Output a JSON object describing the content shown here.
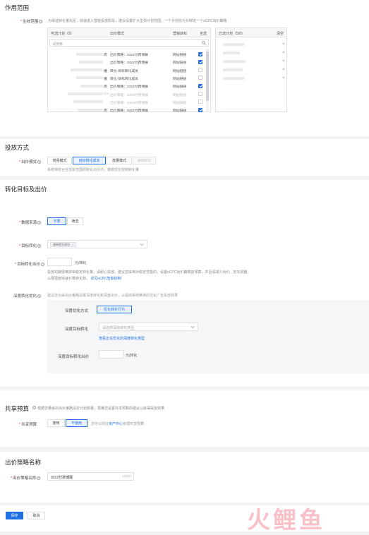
{
  "scope": {
    "title": "作用范围",
    "label": "生效范围",
    "hint": "为保证转化量充足，快速进入智能投放阶段，建议设置扩大生效计划范围。一个计划仅允许绑定一个oCPC出价策略",
    "available": {
      "header": "可选计划（8）",
      "col_bid": "出价模式",
      "col_target": "营销目标",
      "select_all": "全选",
      "search_placeholder": "请搜索",
      "rows": [
        {
          "suffix": "周",
          "bid": "出价策略：0322付费博展",
          "target": "网站链接",
          "checked": true,
          "muted": false
        },
        {
          "suffix": "",
          "bid": "出价策略：0322付费博展",
          "target": "网站链接",
          "checked": true,
          "muted": false
        },
        {
          "suffix": "槽",
          "bid": "转化-目标转化成本",
          "target": "网站链接",
          "checked": false,
          "muted": false
        },
        {
          "suffix": "槽",
          "bid": "转化-目标转化成本",
          "target": "网站链接",
          "checked": false,
          "muted": false
        },
        {
          "suffix": "周",
          "bid": "出价策略：0322付费博展",
          "target": "网站链接",
          "checked": true,
          "muted": false
        },
        {
          "suffix": "GX",
          "bid": "出价策略：0322付费博展",
          "target": "网站链接",
          "checked": false,
          "muted": true
        },
        {
          "suffix": "",
          "bid": "出价策略：0322付费博展",
          "target": "网站链接",
          "checked": false,
          "muted": true
        },
        {
          "suffix": "周",
          "bid": "出价策略：0322付费博展",
          "target": "网站链接",
          "checked": true,
          "muted": false
        }
      ]
    },
    "selected": {
      "header": "已选计划（5/8）",
      "clear": "清空",
      "count": 5
    }
  },
  "bidding": {
    "title": "投放方式",
    "label": "出价模式",
    "options": [
      "增强模式",
      "目标转化成本",
      "放量模式",
      "目标ROI"
    ],
    "active_index": 1,
    "disabled_index": 3,
    "hint": "系统将结合在放投范围的转化出价内，着眼优化控制转化量"
  },
  "conversion": {
    "title": "转化目标及出价",
    "source_label": "数据来源",
    "source_options": [
      "不限",
      "筛选"
    ],
    "source_active": 0,
    "target_label": "目标转化",
    "target_tag": "表单提交成功",
    "price_label": "目标转化出价",
    "price_unit": "元/转化",
    "price_hint": "投放初期很难获得稳定转化量，请耐心投放。建议您采用对稳定性能的，设置oCPC出价策略前预算，并且请减少出价、定向调整，以便更能快速计算转化数。",
    "price_link": "详见oCPC智能控制",
    "deep_label": "深度转化优化",
    "deep_hint": "建议您为采出价策略设置深度转化和深度出价，以提高系统精准的优化广告投放效果",
    "deep_mode_label": "深度优化方式",
    "deep_mode_btn": "优化转化行为",
    "deep_target_label": "深度目标转化",
    "deep_target_placeholder": "请选择深度转化类型",
    "deep_target_link": "查看正在优化的深度转化类型",
    "deep_price_label": "深度目标转化出价",
    "deep_price_unit": "元/转化"
  },
  "budget": {
    "title": "共享预算",
    "hint": "根据您量级的出价策略设定计划数量，再推您设置共享预算的建议以获得投放效果",
    "label": "共享预算",
    "options": [
      "使用",
      "不使用"
    ],
    "active_index": 1,
    "note_prefix": "您可以前往",
    "note_link": "资产中心",
    "note_suffix": "管理共享预算"
  },
  "strategy": {
    "title": "出价策略名称",
    "label": "出价策略名称",
    "value": "0322付费博展",
    "counter": "14/20"
  },
  "footer": {
    "save": "保存",
    "cancel": "取消"
  },
  "watermark": "火鲤鱼",
  "colors": {
    "primary": "#1f6fe5",
    "watermark": "#f26b7c"
  }
}
